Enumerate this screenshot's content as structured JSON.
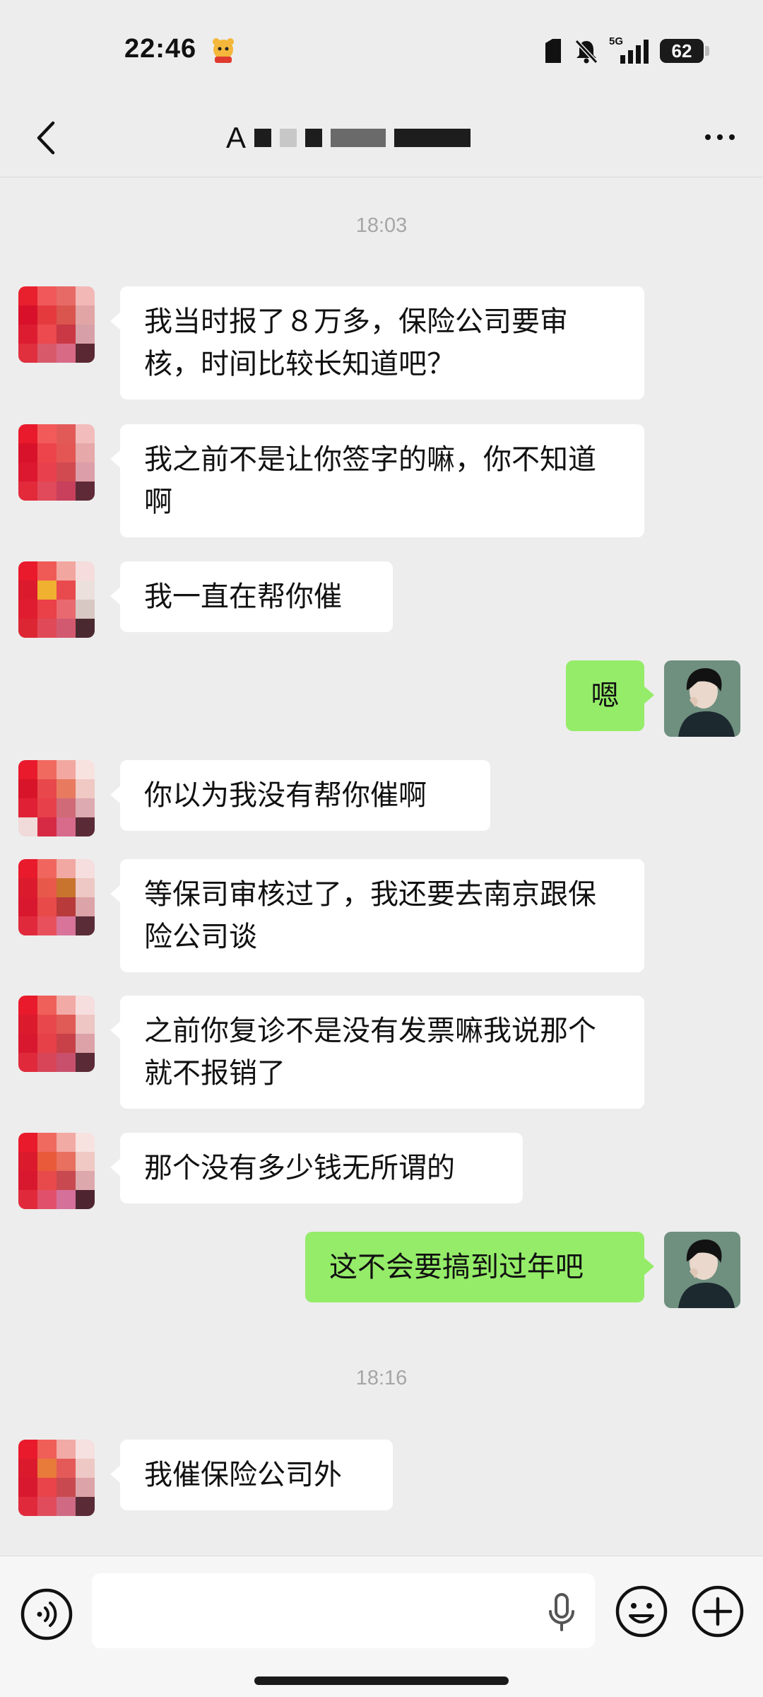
{
  "status_bar": {
    "time": "22:46",
    "network": "5G",
    "battery": "62"
  },
  "header": {
    "title_prefix": "A"
  },
  "colors": {
    "outgoing_bubble": "#95ec69",
    "incoming_bubble": "#ffffff",
    "background": "#ededed"
  },
  "messages": [
    {
      "type": "time",
      "text": "18:03"
    },
    {
      "type": "in",
      "text": "我当时报了８万多，保险公司要审核，时间比较长知道吧？"
    },
    {
      "type": "in",
      "text": "我之前不是让你签字的嘛，你不知道啊"
    },
    {
      "type": "in",
      "text": "我一直在帮你催"
    },
    {
      "type": "out",
      "text": "嗯"
    },
    {
      "type": "in",
      "text": "你以为我没有帮你催啊"
    },
    {
      "type": "in",
      "text": "等保司审核过了，我还要去南京跟保险公司谈"
    },
    {
      "type": "in",
      "text": "之前你复诊不是没有发票嘛我说那个就不报销了"
    },
    {
      "type": "in",
      "text": "那个没有多少钱无所谓的"
    },
    {
      "type": "out",
      "text": "这不会要搞到过年吧"
    },
    {
      "type": "time",
      "text": "18:16"
    },
    {
      "type": "in",
      "text": "我催保险公司外"
    }
  ],
  "input_bar": {
    "value": "",
    "voice_icon": "voice-icon",
    "mic_icon": "microphone-icon",
    "emoji_icon": "emoji-icon",
    "plus_icon": "plus-icon"
  }
}
